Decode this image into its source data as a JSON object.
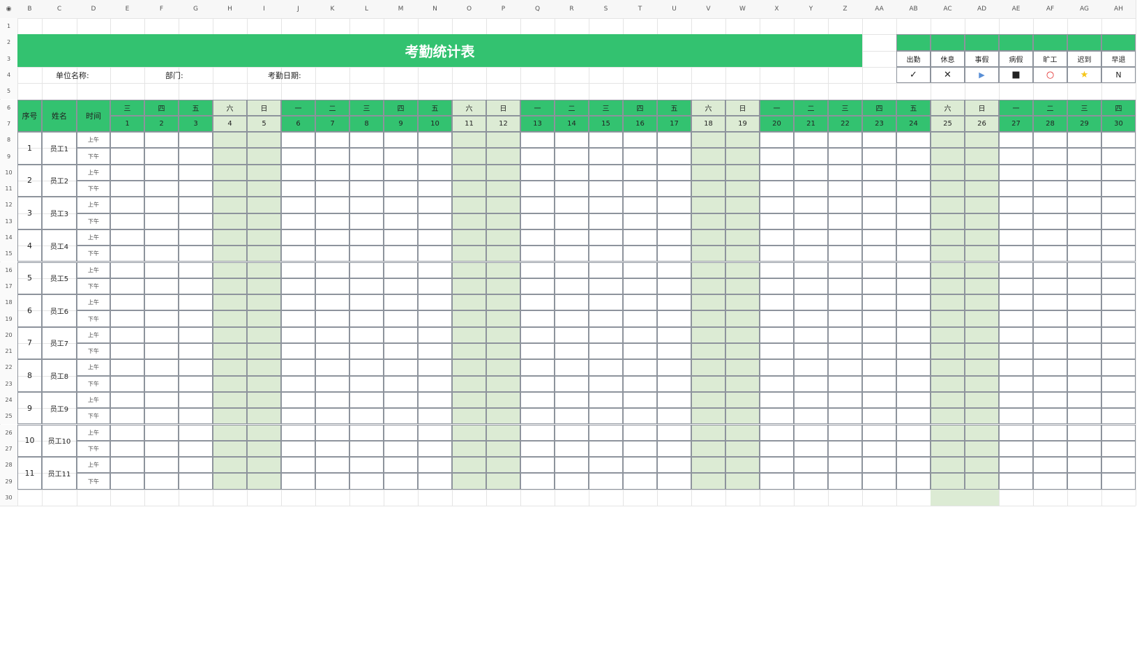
{
  "colors": {
    "green": "#33c270",
    "green_light": "#dcebd4",
    "grid": "#e4e4e4",
    "table_border": "#8d939c",
    "absent_red": "#e02020",
    "leave_blue": "#5a8fd6",
    "late_star": "#f5c518"
  },
  "col_letters": [
    "B",
    "C",
    "D",
    "E",
    "F",
    "G",
    "H",
    "I",
    "J",
    "K",
    "L",
    "M",
    "N",
    "O",
    "P",
    "Q",
    "R",
    "S",
    "T",
    "U",
    "V",
    "W",
    "X",
    "Y",
    "Z",
    "AA",
    "AB",
    "AC",
    "AD",
    "AE",
    "AF",
    "AG",
    "AH"
  ],
  "row_numbers": [
    "1",
    "2",
    "3",
    "4",
    "5",
    "6",
    "7",
    "8",
    "9",
    "10",
    "11",
    "12",
    "13",
    "14",
    "15",
    "16",
    "17",
    "18",
    "19",
    "20",
    "21",
    "22",
    "23",
    "24",
    "25",
    "26",
    "27",
    "28",
    "29",
    "30"
  ],
  "title": "考勤统计表",
  "info": {
    "unit_label": "单位名称:",
    "dept_label": "部门:",
    "date_label": "考勤日期:"
  },
  "legend": {
    "labels": [
      "出勤",
      "休息",
      "事假",
      "病假",
      "旷工",
      "迟到",
      "早退"
    ],
    "symbols": [
      "✓",
      "✕",
      "▶",
      "■",
      "○",
      "★",
      "N"
    ],
    "symbol_icons": [
      "check-icon",
      "cross-icon",
      "play-icon",
      "black-square-icon",
      "red-circle-icon",
      "star-icon",
      "n-letter-icon"
    ]
  },
  "table": {
    "header_seq": "序号",
    "header_name": "姓名",
    "header_time": "时间",
    "weekdays": [
      "三",
      "四",
      "五",
      "六",
      "日",
      "一",
      "二",
      "三",
      "四",
      "五",
      "六",
      "日",
      "一",
      "二",
      "三",
      "四",
      "五",
      "六",
      "日",
      "一",
      "二",
      "三",
      "四",
      "五",
      "六",
      "日",
      "一",
      "二",
      "三",
      "四"
    ],
    "days": [
      "1",
      "2",
      "3",
      "4",
      "5",
      "6",
      "7",
      "8",
      "9",
      "10",
      "11",
      "12",
      "13",
      "14",
      "15",
      "16",
      "17",
      "18",
      "19",
      "20",
      "21",
      "22",
      "23",
      "24",
      "25",
      "26",
      "27",
      "28",
      "29",
      "30"
    ],
    "morning": "上午",
    "afternoon": "下午",
    "employees": [
      {
        "seq": "1",
        "name": "员工1"
      },
      {
        "seq": "2",
        "name": "员工2"
      },
      {
        "seq": "3",
        "name": "员工3"
      },
      {
        "seq": "4",
        "name": "员工4"
      },
      {
        "seq": "5",
        "name": "员工5"
      },
      {
        "seq": "6",
        "name": "员工6"
      },
      {
        "seq": "7",
        "name": "员工7"
      },
      {
        "seq": "8",
        "name": "员工8"
      },
      {
        "seq": "9",
        "name": "员工9"
      },
      {
        "seq": "10",
        "name": "员工10"
      },
      {
        "seq": "11",
        "name": "员工11"
      }
    ]
  }
}
